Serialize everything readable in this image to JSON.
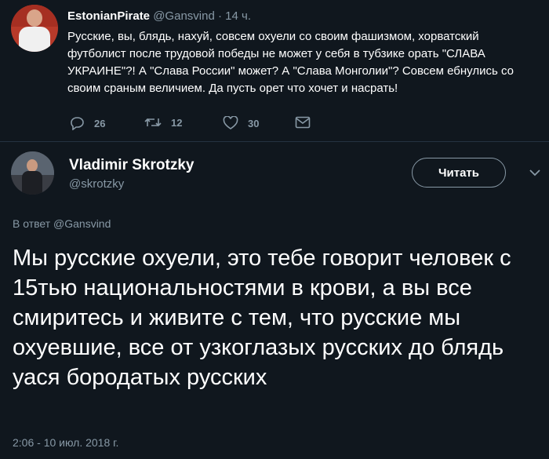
{
  "tweet1": {
    "name": "EstonianPirate",
    "handle": "@Gansvind",
    "separator": "·",
    "time": "14 ч.",
    "text": "Русские, вы, блядь, нахуй, совсем охуели со своим фашизмом, хорватский футболист после трудовой победы не может у себя в тубзике орать \"СЛАВА УКРАИНЕ\"?! А \"Слава России\" может? А \"Слава Монголии\"? Совсем ебнулись со своим сраным величием. Да пусть орет что хочет и насрать!",
    "actions": {
      "replies": "26",
      "retweets": "12",
      "likes": "30"
    }
  },
  "tweet2": {
    "name": "Vladimir Skrotzky",
    "handle": "@skrotzky",
    "follow_label": "Читать",
    "reply_to": "В ответ @Gansvind",
    "text": "Мы русские охуели, это тебе говорит человек с 15тью национальностями в крови, а вы все смиритесь и живите с тем, что русские мы охуевшие, все от узкоглазых русских до блядь уася бородатых русских",
    "timestamp": "2:06 - 10 июл. 2018 г."
  },
  "colors": {
    "background": "#10171e",
    "muted": "#8899a6",
    "text": "#ffffff"
  }
}
